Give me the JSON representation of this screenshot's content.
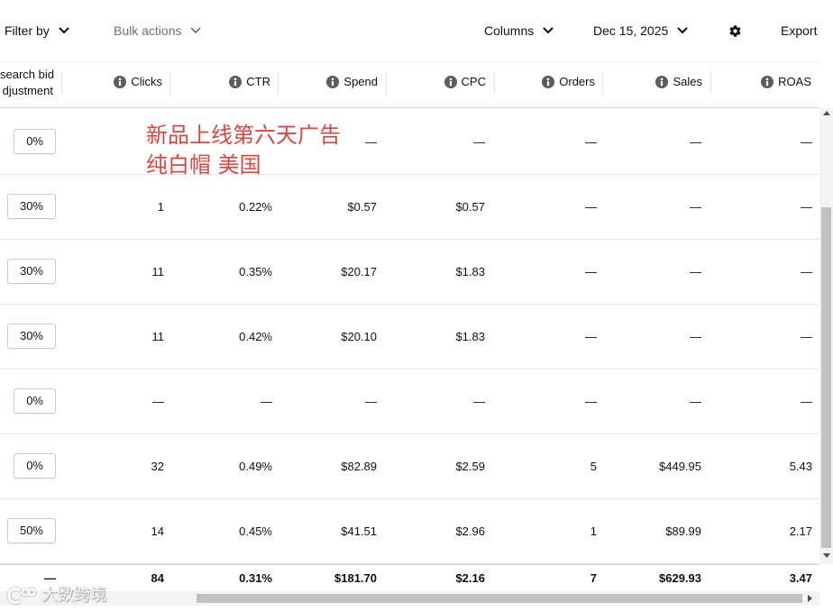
{
  "toolbar": {
    "filter_label": "Filter by",
    "bulk_actions_label": "Bulk actions",
    "columns_label": "Columns",
    "date_label": "Dec 15, 2025",
    "settings_icon": "gear-icon",
    "export_label": "Export"
  },
  "table": {
    "header": {
      "bid_adjustment_line1": "search bid",
      "bid_adjustment_line2": "djustment",
      "clicks": "Clicks",
      "ctr": "CTR",
      "spend": "Spend",
      "cpc": "CPC",
      "orders": "Orders",
      "sales": "Sales",
      "roas": "ROAS",
      "info_icon": "info-icon"
    },
    "rows": [
      {
        "bid_adjustment": "0%",
        "spend": "—",
        "cpc": "—",
        "orders": "—",
        "sales": "—",
        "roas": "—"
      },
      {
        "bid_adjustment": "30%",
        "clicks": "1",
        "ctr": "0.22%",
        "spend": "$0.57",
        "cpc": "$0.57",
        "orders": "—",
        "sales": "—",
        "roas": "—"
      },
      {
        "bid_adjustment": "30%",
        "clicks": "11",
        "ctr": "0.35%",
        "spend": "$20.17",
        "cpc": "$1.83",
        "orders": "—",
        "sales": "—",
        "roas": "—"
      },
      {
        "bid_adjustment": "30%",
        "clicks": "11",
        "ctr": "0.42%",
        "spend": "$20.10",
        "cpc": "$1.83",
        "orders": "—",
        "sales": "—",
        "roas": "—"
      },
      {
        "bid_adjustment": "0%",
        "clicks": "—",
        "ctr": "—",
        "spend": "—",
        "cpc": "—",
        "orders": "—",
        "sales": "—",
        "roas": "—"
      },
      {
        "bid_adjustment": "0%",
        "clicks": "32",
        "ctr": "0.49%",
        "spend": "$82.89",
        "cpc": "$2.59",
        "orders": "5",
        "sales": "$449.95",
        "roas": "5.43"
      },
      {
        "bid_adjustment": "50%",
        "clicks": "14",
        "ctr": "0.45%",
        "spend": "$41.51",
        "cpc": "$2.96",
        "orders": "1",
        "sales": "$89.99",
        "roas": "2.17"
      }
    ],
    "totals": {
      "bid_adjustment": "—",
      "clicks": "84",
      "ctr": "0.31%",
      "spend": "$181.70",
      "cpc": "$2.16",
      "orders": "7",
      "sales": "$629.93",
      "roas": "3.47"
    }
  },
  "annotation": {
    "line1": "新品上线第六天广告",
    "line2": "纯白帽 美国",
    "color": "#e0453d"
  },
  "watermark": {
    "text": "大数跨境",
    "logo_icon": "watermark-logo-icon"
  },
  "colors": {
    "text": "#0f1111",
    "muted": "#6f7373",
    "info_icon": "#5a5e5e",
    "annotation_red": "#e0453d"
  }
}
